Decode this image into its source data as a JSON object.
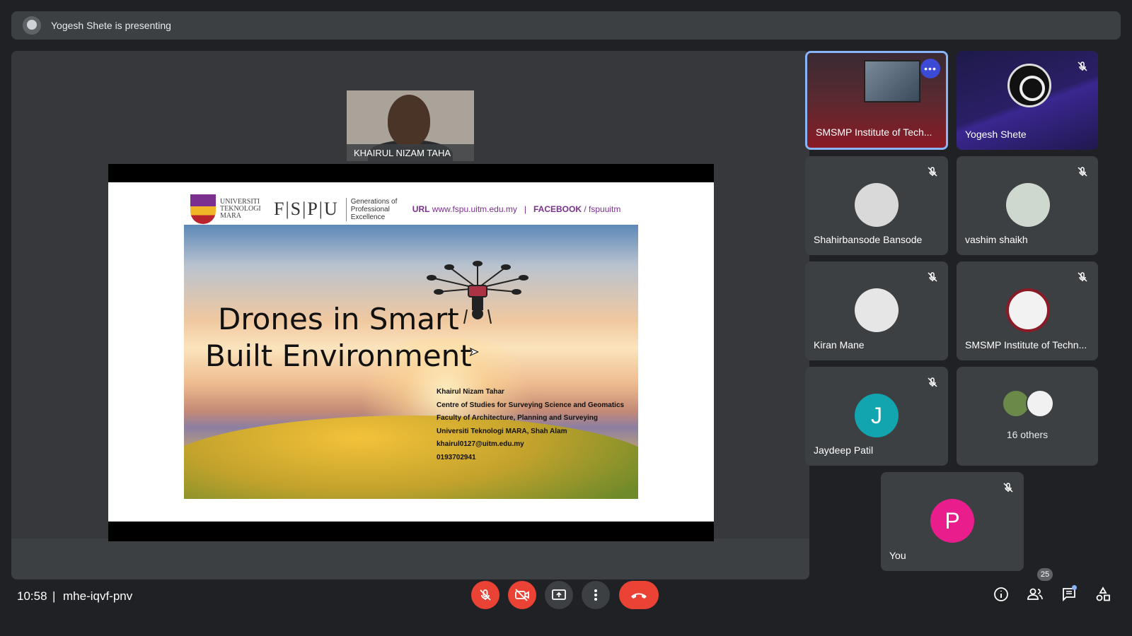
{
  "banner": {
    "text": "Yogesh Shete is presenting"
  },
  "pip": {
    "name": "KHAIRUL NIZAM TAHA"
  },
  "slide": {
    "uitm": [
      "UNIVERSITI",
      "TEKNOLOGI",
      "MARA"
    ],
    "fspu": "F|S|P|U",
    "generations": [
      "Generations of",
      "Professional",
      "Excellence"
    ],
    "url_label": "URL",
    "url": "www.fspu.uitm.edu.my",
    "separator": "|",
    "fb_label": "FACEBOOK",
    "fb": "/ fspuuitm",
    "title_line1": "Drones in Smart",
    "title_line2": "Built Environment",
    "author_lines": [
      "Khairul Nizam Tahar",
      "Centre of Studies for Surveying Science and Geomatics",
      "Faculty of Architecture, Planning and Surveying",
      "Universiti Teknologi MARA, Shah Alam",
      "khairul0127@uitm.edu.my",
      "0193702941"
    ]
  },
  "participants": [
    {
      "name": "SMSMP Institute of Tech...",
      "type": "video",
      "active": true
    },
    {
      "name": "Yogesh Shete",
      "type": "obs"
    },
    {
      "name": "Shahirbansode Bansode",
      "type": "photo",
      "color": "#d9d9d9"
    },
    {
      "name": "vashim shaikh",
      "type": "photo",
      "color": "#cfd8cf"
    },
    {
      "name": "Kiran Mane",
      "type": "photo",
      "color": "#e6e6e6"
    },
    {
      "name": "SMSMP Institute of Techn...",
      "type": "seal",
      "color": "#f2f2f2"
    },
    {
      "name": "Jaydeep Patil",
      "type": "letter",
      "letter": "J",
      "color": "#12a4af"
    },
    {
      "name": "16 others",
      "type": "others"
    },
    {
      "name": "You",
      "type": "letter",
      "letter": "P",
      "color": "#e91e8c"
    }
  ],
  "controls": {
    "time": "10:58",
    "separator": "|",
    "meeting_code": "mhe-iqvf-pnv",
    "people_count": "25",
    "icons": [
      "mic-off-icon",
      "camera-off-icon",
      "present-icon",
      "more-options-icon",
      "end-call-icon",
      "info-icon",
      "people-icon",
      "chat-icon",
      "activities-icon"
    ]
  },
  "colors": {
    "background": "#202124",
    "tile": "#3c4043",
    "danger": "#ea4335",
    "accent": "#8ab4f8"
  }
}
